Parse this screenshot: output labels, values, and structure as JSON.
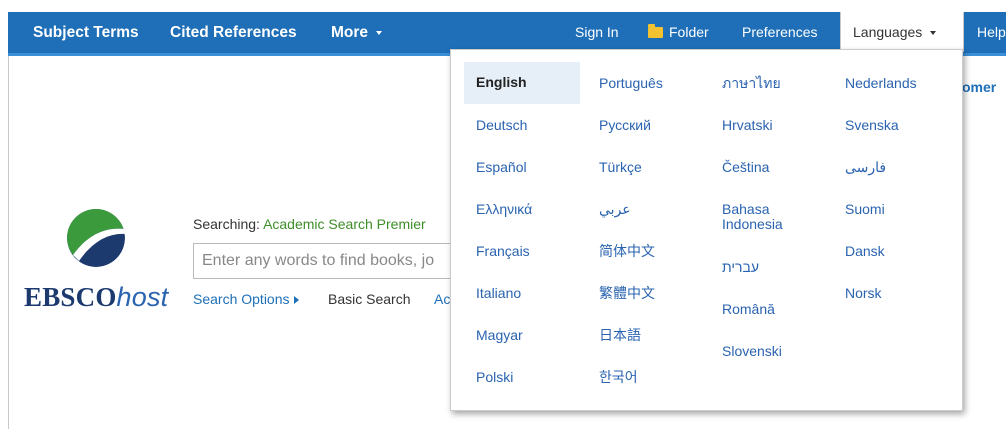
{
  "nav": {
    "subject_terms": "Subject Terms",
    "cited_references": "Cited References",
    "more": "More",
    "sign_in": "Sign In",
    "folder": "Folder",
    "preferences": "Preferences",
    "languages": "Languages",
    "help": "Help"
  },
  "header_right": {
    "customer_partial": "omer"
  },
  "search": {
    "searching_label": "Searching:",
    "database": "Academic Search Premier",
    "placeholder": "Enter any words to find books, jo",
    "search_options": "Search Options",
    "basic_search": "Basic Search",
    "advanced_partial": "Ac"
  },
  "logo": {
    "ebsco": "EBSCO",
    "host": "host"
  },
  "languages_menu": {
    "selected": "English",
    "col1": [
      "English",
      "Deutsch",
      "Español",
      "Ελληνικά",
      "Français",
      "Italiano",
      "Magyar",
      "Polski"
    ],
    "col2": [
      "Português",
      "Русский",
      "Türkçe",
      "عربي",
      "简体中文",
      "繁體中文",
      "日本語",
      "한국어"
    ],
    "col3": [
      "ภาษาไทย",
      "Hrvatski",
      "Čeština",
      "Bahasa Indonesia",
      "עברית",
      "Română",
      "Slovenski"
    ],
    "col4": [
      "Nederlands",
      "Svenska",
      "فارسی",
      "Suomi",
      "Dansk",
      "Norsk"
    ]
  },
  "colors": {
    "topbar": "#1e6fb8",
    "link": "#2a63b0",
    "database_green": "#3e8e2a",
    "logo_green": "#3a9a3c",
    "logo_navy": "#1c3a6e",
    "folder_yellow": "#f2c230"
  }
}
